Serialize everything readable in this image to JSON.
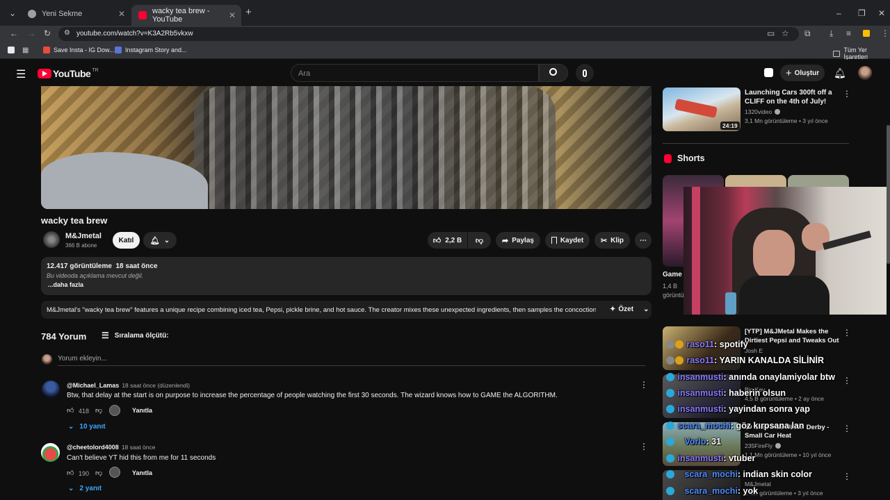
{
  "browser": {
    "tabs": [
      {
        "title": "Yeni Sekme"
      },
      {
        "title": "wacky tea brew - YouTube"
      }
    ],
    "url": "youtube.com/watch?v=K3A2Rb5vkxw",
    "bookmarks": [
      "Save Insta - IG Dow...",
      "Instagram Story and..."
    ],
    "bookmarks_right": "Tüm Yer İşaretleri"
  },
  "header": {
    "logo": "YouTube",
    "country": "TR",
    "search_placeholder": "Ara",
    "create_label": "Oluştur"
  },
  "video": {
    "title": "wacky tea brew",
    "channel": "M&Jmetal",
    "subscribers": "366 B abone",
    "join_label": "Katıl",
    "likes": "2,2 B",
    "share_label": "Paylaş",
    "save_label": "Kaydet",
    "clip_label": "Klip",
    "views_time": "12.417 görüntüleme  18 saat önce",
    "no_description": "Bu videoda açıklama mevcut değil.",
    "more_label": "...daha fazla",
    "summary": "M&Jmetal's \"wacky tea brew\" features a unique recipe combining iced tea, Pepsi, pickle brine, and hot sauce. The creator mixes these unexpected ingredients, then samples the concoction,...",
    "summary_label": "Özet"
  },
  "comments": {
    "count_label": "784 Yorum",
    "sort_label": "Sıralama ölçütü:",
    "add_placeholder": "Yorum ekleyin...",
    "reply_label": "Yanıtla",
    "items": [
      {
        "author": "@Michael_Lamas",
        "meta": "18 saat önce (düzenlendi)",
        "text": "Btw, that delay at the start is on purpose to increase the percentage of people watching the first 30 seconds. The wizard knows how to GAME the ALGORITHM.",
        "likes": "418",
        "replies": "10 yanıt"
      },
      {
        "author": "@cheetolord4008",
        "meta": "18 saat önce",
        "text": "Can't believe YT hid this from me for 11 seconds",
        "likes": "190",
        "replies": "2 yanıt"
      }
    ]
  },
  "sidebar": {
    "top_video": {
      "title_line1": "Launching Cars 300ft off a",
      "title_line2": "CLIFF on the 4th of July!",
      "channel": "1320video",
      "meta": "3,1 Mn görüntüleme • 3 yıl önce",
      "duration": "24:19"
    },
    "shorts_label": "Shorts",
    "short_partial": {
      "title": "Game",
      "meta1": "1,4 B",
      "meta2": "görüntü"
    },
    "list": [
      {
        "title1": "[YTP] M&JMetal Makes the",
        "title2": "Dirtiest Pepsi and Tweaks Out",
        "channel": "Josh E",
        "meta": ""
      },
      {
        "title1": "",
        "title2": "",
        "channel": "Big Key",
        "meta": "4,5 B görüntüleme • 2 ay önce"
      },
      {
        "title1": "20 Cars Demolition Derby -",
        "title2": "Small Car Heat",
        "channel": "235FireFly",
        "meta": "1,1 Mn görüntüleme • 10 yıl önce"
      },
      {
        "title1": "",
        "title2": "",
        "channel": "M&Jmetal",
        "meta": "1 Mn görüntüleme • 3 yıl önce"
      }
    ]
  },
  "chat": [
    {
      "user": "raso11",
      "msg": ": spotify"
    },
    {
      "user": "raso11",
      "msg": ": YARIN KANALDA SİLİNİR"
    },
    {
      "user": "insanmusti",
      "msg": ": anında onaylamiyolar btw"
    },
    {
      "user": "insanmusti",
      "msg": ": haberin olsun"
    },
    {
      "user": "insanmusti",
      "msg": ": yayindan sonra yap"
    },
    {
      "user": "scara_mochi",
      "msg": ": göz kırpsana lan"
    },
    {
      "user": "Vorlo",
      "msg": ": 31"
    },
    {
      "user": "insanmusti",
      "msg": ": vtuber"
    },
    {
      "user": "scara_mochi",
      "msg": ": indian skin color"
    },
    {
      "user": "scara_mochi",
      "msg": ": yok"
    }
  ],
  "colors": {
    "bg": "#0f0f0f",
    "accent": "#ff0033",
    "chip": "#272727"
  }
}
